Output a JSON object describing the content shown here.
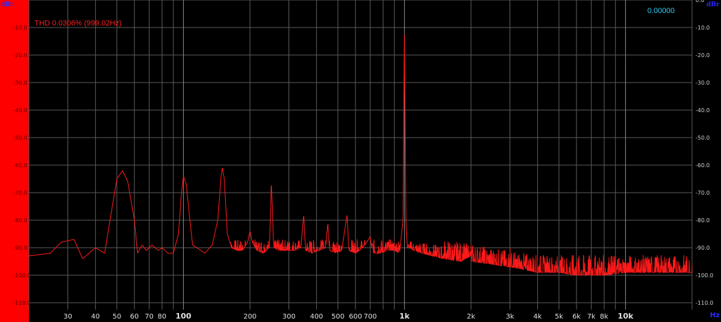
{
  "header": {
    "unit_left": "dBr",
    "unit_right": "dBr",
    "thd_readout": "THD 0.0306% (999.02Hz)",
    "value_readout": "0.00000",
    "x_unit": "Hz"
  },
  "colors": {
    "background": "#000000",
    "left_panel": "#ff0000",
    "trace": "#ff1a1a",
    "grid": "#5a5a5a",
    "grid_major": "#8a8a8a",
    "axis_text": "#dcdcdc",
    "unit_text": "#2a2aff",
    "readout_cyan": "#33ccee"
  },
  "chart_data": {
    "type": "line",
    "title": "",
    "xlabel": "Hz",
    "ylabel": "dBr",
    "x_scale": "log",
    "xlim": [
      20,
      20000
    ],
    "ylim": [
      -110,
      0
    ],
    "grid": true,
    "y_ticks": [
      "0.0",
      "-10.0",
      "-20.0",
      "-30.0",
      "-40.0",
      "-50.0",
      "-60.0",
      "-70.0",
      "-80.0",
      "-90.0",
      "-100.0",
      "-110.0"
    ],
    "y_tick_values": [
      0,
      -10,
      -20,
      -30,
      -40,
      -50,
      -60,
      -70,
      -80,
      -90,
      -100,
      -110
    ],
    "x_ticks": [
      {
        "value": 30,
        "label": "30",
        "bold": false
      },
      {
        "value": 40,
        "label": "40",
        "bold": false
      },
      {
        "value": 50,
        "label": "50",
        "bold": false
      },
      {
        "value": 60,
        "label": "60",
        "bold": false
      },
      {
        "value": 70,
        "label": "70",
        "bold": false
      },
      {
        "value": 80,
        "label": "80",
        "bold": false
      },
      {
        "value": 100,
        "label": "100",
        "bold": true
      },
      {
        "value": 200,
        "label": "200",
        "bold": false
      },
      {
        "value": 300,
        "label": "300",
        "bold": false
      },
      {
        "value": 400,
        "label": "400",
        "bold": false
      },
      {
        "value": 500,
        "label": "500",
        "bold": false
      },
      {
        "value": 600,
        "label": "600",
        "bold": false
      },
      {
        "value": 700,
        "label": "700",
        "bold": false
      },
      {
        "value": 1000,
        "label": "1k",
        "bold": true
      },
      {
        "value": 2000,
        "label": "2k",
        "bold": false
      },
      {
        "value": 3000,
        "label": "3k",
        "bold": false
      },
      {
        "value": 4000,
        "label": "4k",
        "bold": false
      },
      {
        "value": 5000,
        "label": "5k",
        "bold": false
      },
      {
        "value": 6000,
        "label": "6k",
        "bold": false
      },
      {
        "value": 7000,
        "label": "7k",
        "bold": false
      },
      {
        "value": 8000,
        "label": "8k",
        "bold": false
      },
      {
        "value": 10000,
        "label": "10k",
        "bold": true
      }
    ],
    "minor_grid_x": [
      20,
      30,
      40,
      50,
      60,
      70,
      80,
      90,
      100,
      200,
      300,
      400,
      500,
      600,
      700,
      800,
      900,
      1000,
      2000,
      3000,
      4000,
      5000,
      6000,
      7000,
      8000,
      9000,
      10000,
      20000
    ],
    "series": [
      {
        "type": "spectrum",
        "points": [
          [
            20,
            -93
          ],
          [
            25,
            -92
          ],
          [
            28,
            -88
          ],
          [
            32,
            -87
          ],
          [
            35,
            -94
          ],
          [
            40,
            -90
          ],
          [
            44,
            -92
          ],
          [
            47,
            -78
          ],
          [
            50,
            -65
          ],
          [
            53,
            -62
          ],
          [
            56,
            -66
          ],
          [
            60,
            -80
          ],
          [
            62,
            -92
          ],
          [
            65,
            -89
          ],
          [
            68,
            -91
          ],
          [
            72,
            -89
          ],
          [
            77,
            -91
          ],
          [
            80,
            -90
          ],
          [
            85,
            -92
          ],
          [
            90,
            -92
          ],
          [
            95,
            -85
          ],
          [
            98,
            -70
          ],
          [
            100,
            -64
          ],
          [
            103,
            -67
          ],
          [
            107,
            -80
          ],
          [
            110,
            -89
          ],
          [
            115,
            -90
          ],
          [
            125,
            -92
          ],
          [
            135,
            -89
          ],
          [
            143,
            -80
          ],
          [
            148,
            -64
          ],
          [
            150,
            -61
          ],
          [
            153,
            -65
          ],
          [
            158,
            -85
          ],
          [
            165,
            -90
          ],
          [
            175,
            -91
          ],
          [
            185,
            -91
          ],
          [
            195,
            -88
          ],
          [
            200,
            -84
          ],
          [
            205,
            -88
          ],
          [
            215,
            -91
          ],
          [
            230,
            -92
          ],
          [
            245,
            -90
          ],
          [
            250,
            -66
          ],
          [
            256,
            -90
          ],
          [
            270,
            -91
          ],
          [
            290,
            -91
          ],
          [
            315,
            -91
          ],
          [
            340,
            -90
          ],
          [
            350,
            -78
          ],
          [
            357,
            -91
          ],
          [
            380,
            -92
          ],
          [
            410,
            -91
          ],
          [
            440,
            -90
          ],
          [
            450,
            -81
          ],
          [
            458,
            -91
          ],
          [
            490,
            -92
          ],
          [
            520,
            -91
          ],
          [
            550,
            -78
          ],
          [
            560,
            -91
          ],
          [
            600,
            -92
          ],
          [
            650,
            -90
          ],
          [
            700,
            -86
          ],
          [
            715,
            -92
          ],
          [
            780,
            -92
          ],
          [
            840,
            -91
          ],
          [
            900,
            -91
          ],
          [
            950,
            -92
          ],
          [
            985,
            -80
          ],
          [
            995,
            -30
          ],
          [
            999,
            -10
          ],
          [
            1003,
            -30
          ],
          [
            1015,
            -80
          ],
          [
            1030,
            -90
          ],
          [
            1200,
            -92
          ],
          [
            1500,
            -94
          ],
          [
            1800,
            -95
          ],
          [
            1995,
            -93
          ],
          [
            2000,
            -89
          ],
          [
            2005,
            -95
          ],
          [
            2500,
            -96
          ],
          [
            2990,
            -97
          ],
          [
            3000,
            -89
          ],
          [
            3010,
            -97
          ],
          [
            3500,
            -98
          ],
          [
            4000,
            -99
          ],
          [
            5000,
            -99
          ],
          [
            6000,
            -100
          ],
          [
            8000,
            -100
          ],
          [
            10000,
            -99
          ],
          [
            14000,
            -99
          ],
          [
            20000,
            -99
          ]
        ],
        "noise_floor_db": [
          [
            20,
            -92
          ],
          [
            200,
            -91
          ],
          [
            1000,
            -91
          ],
          [
            2000,
            -95
          ],
          [
            4000,
            -99
          ],
          [
            10000,
            -99
          ],
          [
            20000,
            -99
          ]
        ],
        "noise_spread_db": 4
      }
    ]
  }
}
